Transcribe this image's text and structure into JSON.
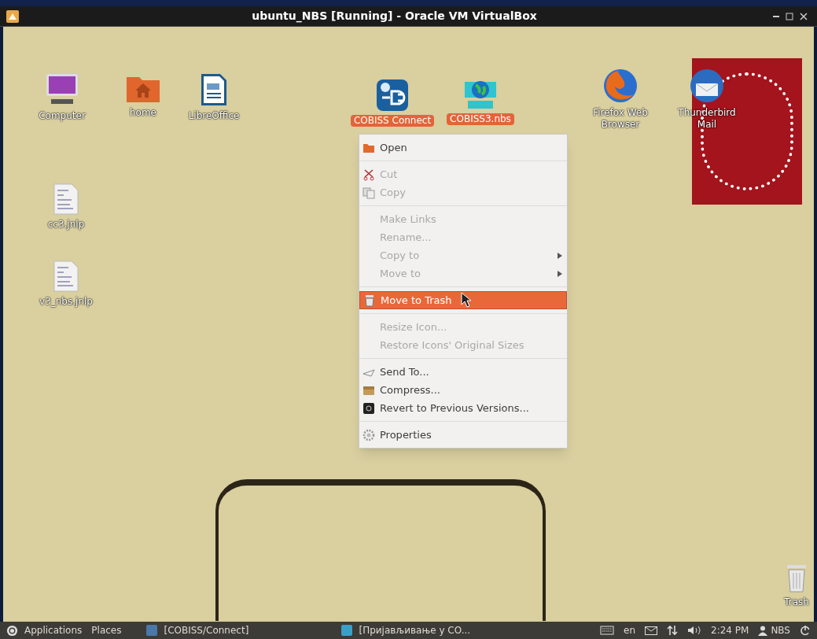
{
  "window": {
    "title": "ubuntu_NBS [Running] - Oracle VM VirtualBox"
  },
  "desktop_icons": [
    {
      "label": "Computer",
      "selected": false
    },
    {
      "label": "home",
      "selected": false
    },
    {
      "label": "LibreOffice",
      "selected": false
    },
    {
      "label": "COBISS Connect",
      "selected": true
    },
    {
      "label": "COBISS3.nbs",
      "selected": true
    },
    {
      "label": "Firefox Web Browser",
      "selected": false
    },
    {
      "label": "Thunderbird Mail",
      "selected": false
    },
    {
      "label": "cc3.jnlp",
      "selected": false
    },
    {
      "label": "v3_nbs.jnlp",
      "selected": false
    },
    {
      "label": "Trash",
      "selected": false
    }
  ],
  "context_menu": [
    {
      "kind": "item",
      "label": "Open",
      "disabled": false,
      "selected": false,
      "submenu": false
    },
    {
      "kind": "separator"
    },
    {
      "kind": "item",
      "label": "Cut",
      "disabled": true,
      "selected": false,
      "submenu": false
    },
    {
      "kind": "item",
      "label": "Copy",
      "disabled": true,
      "selected": false,
      "submenu": false
    },
    {
      "kind": "separator"
    },
    {
      "kind": "item",
      "label": "Make Links",
      "disabled": true,
      "selected": false,
      "submenu": false
    },
    {
      "kind": "item",
      "label": "Rename...",
      "disabled": true,
      "selected": false,
      "submenu": false
    },
    {
      "kind": "item",
      "label": "Copy to",
      "disabled": true,
      "selected": false,
      "submenu": true
    },
    {
      "kind": "item",
      "label": "Move to",
      "disabled": true,
      "selected": false,
      "submenu": true
    },
    {
      "kind": "separator"
    },
    {
      "kind": "item",
      "label": "Move to Trash",
      "disabled": false,
      "selected": true,
      "submenu": false
    },
    {
      "kind": "separator"
    },
    {
      "kind": "item",
      "label": "Resize Icon...",
      "disabled": true,
      "selected": false,
      "submenu": false
    },
    {
      "kind": "item",
      "label": "Restore Icons' Original Sizes",
      "disabled": true,
      "selected": false,
      "submenu": false
    },
    {
      "kind": "separator"
    },
    {
      "kind": "item",
      "label": "Send To...",
      "disabled": false,
      "selected": false,
      "submenu": false
    },
    {
      "kind": "item",
      "label": "Compress...",
      "disabled": false,
      "selected": false,
      "submenu": false
    },
    {
      "kind": "item",
      "label": "Revert to Previous Versions...",
      "disabled": false,
      "selected": false,
      "submenu": false
    },
    {
      "kind": "separator"
    },
    {
      "kind": "item",
      "label": "Properties",
      "disabled": false,
      "selected": false,
      "submenu": false
    }
  ],
  "taskbar": {
    "menus": [
      "Applications",
      "Places"
    ],
    "tasks": [
      "[COBISS/Connect]",
      "[Пријављивање у CO..."
    ],
    "keyboard_layout": "en",
    "clock": "2:24 PM",
    "user": "NBS"
  }
}
